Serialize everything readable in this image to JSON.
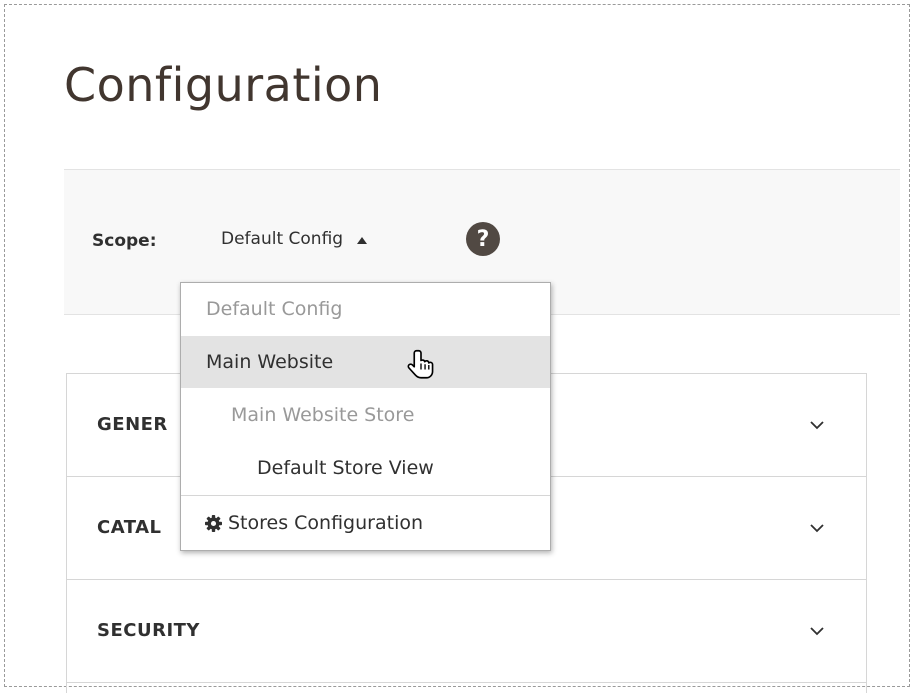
{
  "page": {
    "title": "Configuration"
  },
  "scope": {
    "label": "Scope:",
    "current": "Default Config",
    "help_symbol": "?"
  },
  "dropdown": {
    "items": [
      {
        "label": "Default Config",
        "state": "disabled"
      },
      {
        "label": "Main Website",
        "state": "hover"
      },
      {
        "label": "Main Website Store",
        "state": "disabled"
      },
      {
        "label": "Default Store View",
        "state": "enabled"
      }
    ],
    "footer_label": "Stores Configuration",
    "footer_icon": "gear-icon"
  },
  "sections": [
    {
      "title": "GENER"
    },
    {
      "title": "CATAL"
    },
    {
      "title": "SECURITY"
    }
  ],
  "colors": {
    "title": "#41362f",
    "help_icon_bg": "#514943",
    "hover_bg": "#e3e3e3",
    "disabled_text": "#999999"
  }
}
